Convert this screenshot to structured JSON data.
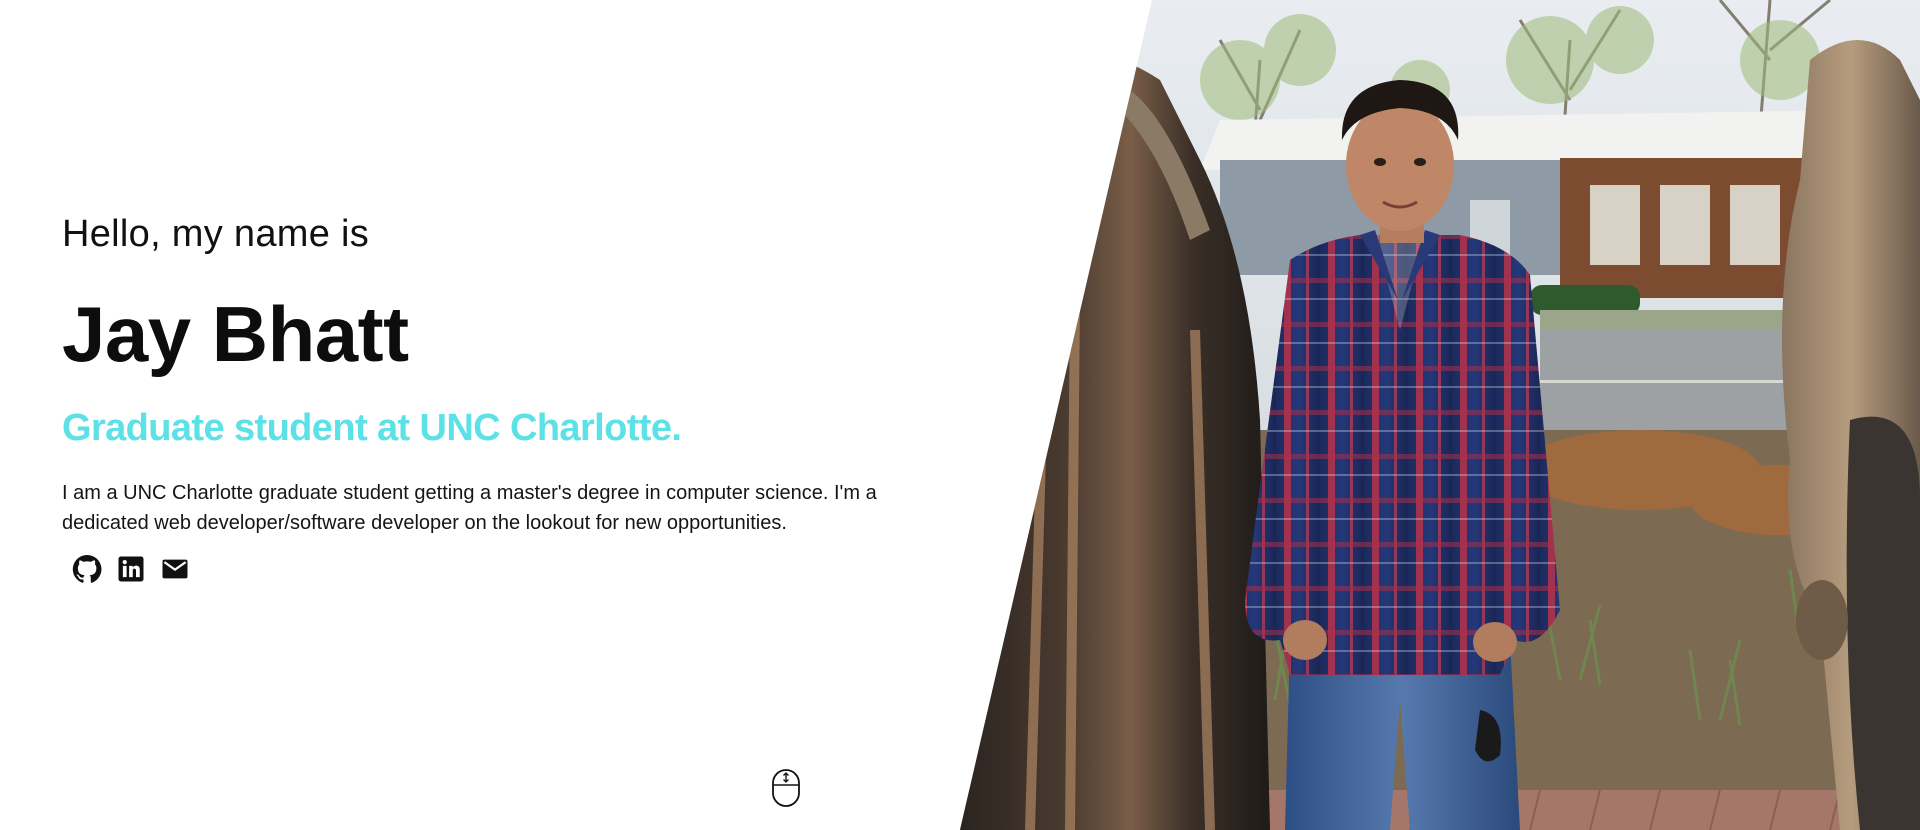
{
  "hero": {
    "greeting": "Hello, my name is",
    "name": "Jay Bhatt",
    "tagline": "Graduate student at UNC Charlotte.",
    "bio": "I am a UNC Charlotte graduate student getting a master's degree in computer science. I'm a dedicated web developer/software developer on the lookout for new opportunities."
  },
  "socials": [
    {
      "label": "GitHub",
      "icon": "github-icon"
    },
    {
      "label": "LinkedIn",
      "icon": "linkedin-icon"
    },
    {
      "label": "Email",
      "icon": "mail-icon"
    }
  ],
  "scroll": {
    "icon": "mouse-scroll-icon"
  },
  "photo": {
    "subject": "portrait-photo"
  },
  "colors": {
    "accent": "#5ce1e6",
    "text": "#111111",
    "background": "#ffffff"
  }
}
